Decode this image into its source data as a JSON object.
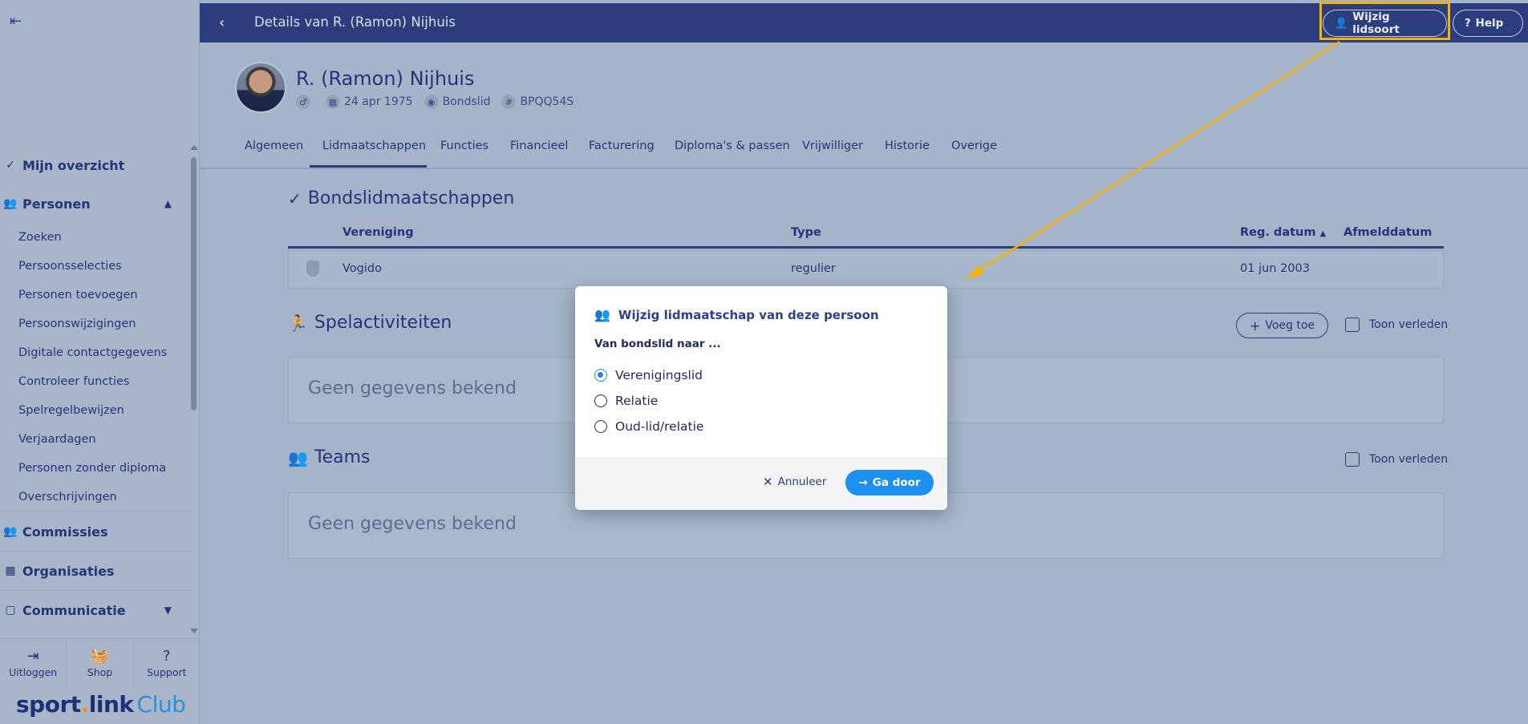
{
  "header": {
    "title": "Details van R. (Ramon) Nijhuis",
    "wijzig_label": "Wijzig lidsoort",
    "help_label": "Help"
  },
  "person": {
    "name": "R. (Ramon) Nijhuis",
    "gender_symbol": "♂",
    "birthdate": "24 apr 1975",
    "member_type": "Bondslid",
    "code": "BPQQ54S"
  },
  "tabs": [
    "Algemeen",
    "Lidmaatschappen",
    "Functies",
    "Financieel",
    "Facturering",
    "Diploma's & passen",
    "Vrijwilliger",
    "Historie",
    "Overige"
  ],
  "active_tab": "Lidmaatschappen",
  "sidebar": {
    "sections": {
      "overzicht": "Mijn overzicht",
      "personen": "Personen",
      "commissies": "Commissies",
      "organisaties": "Organisaties",
      "communicatie": "Communicatie"
    },
    "person_items": [
      "Zoeken",
      "Persoonsselecties",
      "Personen toevoegen",
      "Persoonswijzigingen",
      "Digitale contactgegevens",
      "Controleer functies",
      "Spelregelbewijzen",
      "Verjaardagen",
      "Personen zonder diploma",
      "Overschrijvingen"
    ],
    "bottom": {
      "logout": "Uitloggen",
      "shop": "Shop",
      "support": "Support"
    },
    "logo": {
      "sport": "sport",
      "dot": ".",
      "link": "link",
      "club": "Club"
    }
  },
  "bondslid": {
    "title": "Bondslidmaatschappen",
    "columns": {
      "vereniging": "Vereniging",
      "type": "Type",
      "reg": "Reg. datum",
      "afmeld": "Afmelddatum"
    },
    "row": {
      "vereniging": "Vogido",
      "type": "regulier",
      "reg": "01 jun 2003",
      "afmeld": ""
    }
  },
  "spel": {
    "title": "Spelactiviteiten",
    "add_label": "Voeg toe",
    "show_past": "Toon verleden",
    "empty": "Geen gegevens bekend"
  },
  "teams": {
    "title": "Teams",
    "show_past": "Toon verleden",
    "empty": "Geen gegevens bekend"
  },
  "modal": {
    "title": "Wijzig lidmaatschap van deze persoon",
    "subtitle": "Van bondslid naar ...",
    "options": [
      "Verenigingslid",
      "Relatie",
      "Oud-lid/relatie"
    ],
    "selected": "Verenigingslid",
    "cancel": "Annuleer",
    "proceed": "Ga door"
  },
  "colors": {
    "primary": "#2c3d7d",
    "accent": "#1e90f0",
    "highlight": "#f5b200"
  }
}
